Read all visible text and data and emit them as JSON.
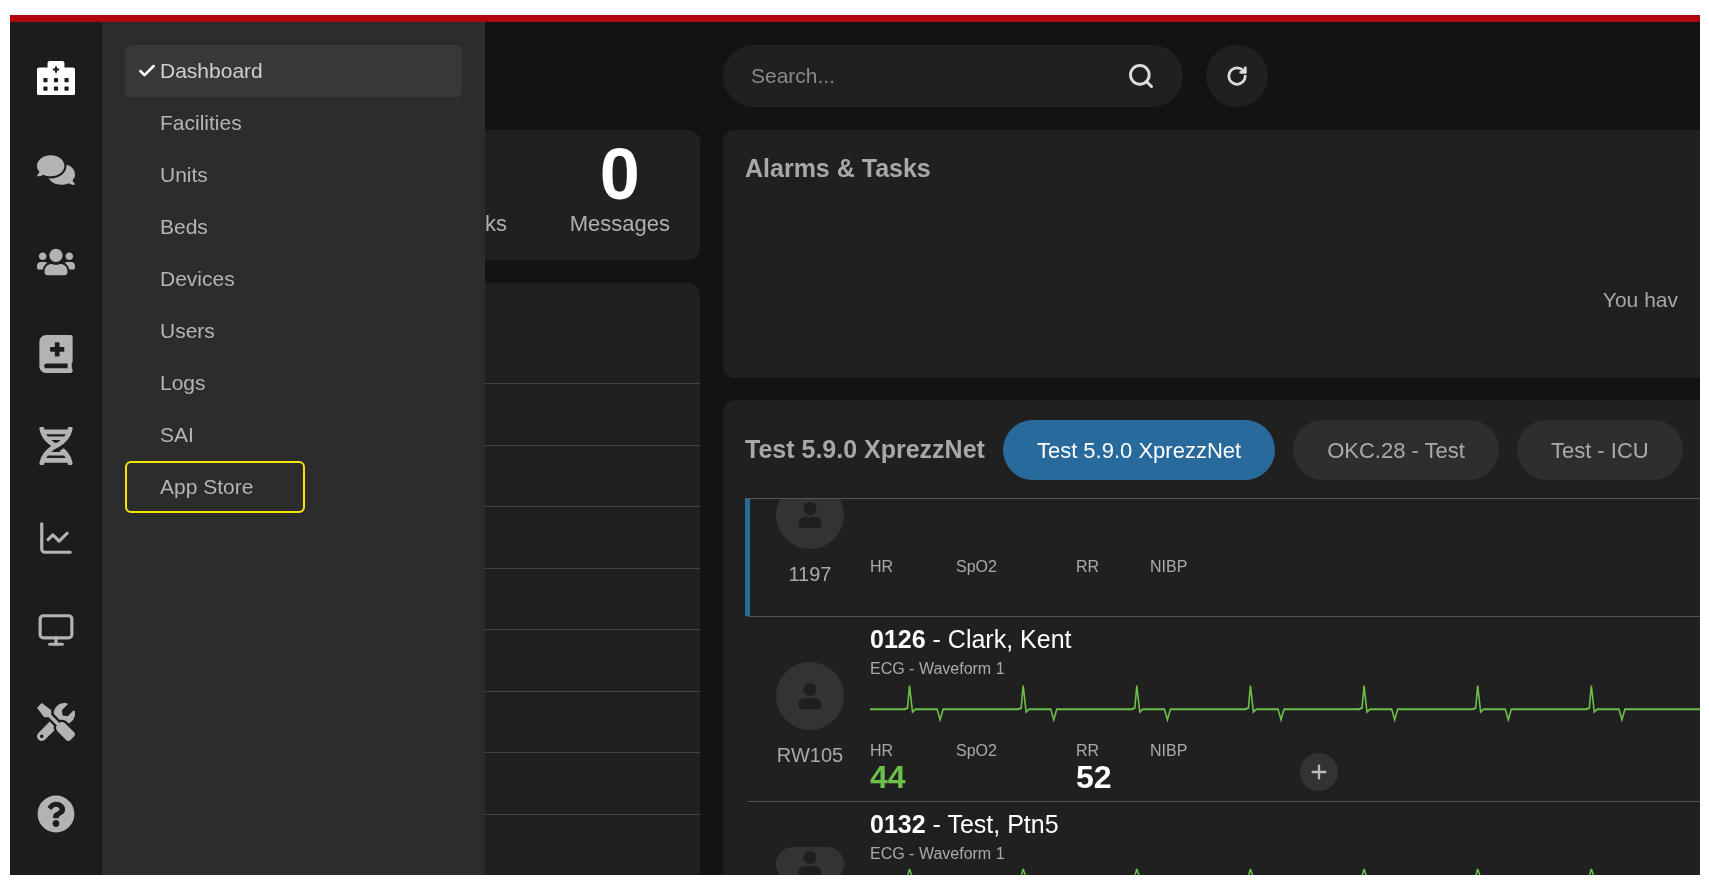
{
  "rail_items": [
    {
      "kind": "hospital",
      "selected": true
    },
    {
      "kind": "chat",
      "selected": false
    },
    {
      "kind": "users",
      "selected": false
    },
    {
      "kind": "library",
      "selected": false
    },
    {
      "kind": "dna",
      "selected": false
    },
    {
      "kind": "chart",
      "selected": false
    },
    {
      "kind": "monitor",
      "selected": false
    },
    {
      "kind": "tools",
      "selected": false
    },
    {
      "kind": "help",
      "selected": false
    }
  ],
  "menu": {
    "items": [
      {
        "label": "Dashboard",
        "selected": true,
        "highlighted": false
      },
      {
        "label": "Facilities",
        "selected": false,
        "highlighted": false
      },
      {
        "label": "Units",
        "selected": false,
        "highlighted": false
      },
      {
        "label": "Beds",
        "selected": false,
        "highlighted": false
      },
      {
        "label": "Devices",
        "selected": false,
        "highlighted": false
      },
      {
        "label": "Users",
        "selected": false,
        "highlighted": false
      },
      {
        "label": "Logs",
        "selected": false,
        "highlighted": false
      },
      {
        "label": "SAI",
        "selected": false,
        "highlighted": false
      },
      {
        "label": "App Store",
        "selected": false,
        "highlighted": true
      }
    ]
  },
  "search": {
    "placeholder": "Search..."
  },
  "stats": [
    {
      "label": "ks"
    },
    {
      "value": "0",
      "label": "Messages"
    }
  ],
  "alarms": {
    "title": "Alarms & Tasks",
    "message": "You hav"
  },
  "patients": {
    "title": "Test 5.9.0 XprezzNet",
    "tabs": [
      {
        "label": "Test 5.9.0 XprezzNet",
        "selected": true
      },
      {
        "label": "OKC.28 - Test",
        "selected": false
      },
      {
        "label": "Test - ICU",
        "selected": false
      }
    ],
    "rows": [
      {
        "bed": "1197",
        "selected": true,
        "vitals": [
          {
            "label": "HR"
          },
          {
            "label": "SpO2"
          },
          {
            "label": "RR"
          },
          {
            "label": "NIBP"
          }
        ]
      },
      {
        "bed": "RW105",
        "selected": false,
        "title": "**0126** - Clark, Kent",
        "waveform_label": "ECG - Waveform 1",
        "vitals": [
          {
            "label": "HR",
            "value": "44",
            "color": "#6cc04a"
          },
          {
            "label": "SpO2"
          },
          {
            "label": "RR",
            "value": "52",
            "color": "#ffffff"
          },
          {
            "label": "NIBP"
          }
        ]
      },
      {
        "selected": false,
        "title": "**0132** - Test, Ptn5",
        "waveform_label": "ECG - Waveform 1"
      }
    ]
  }
}
